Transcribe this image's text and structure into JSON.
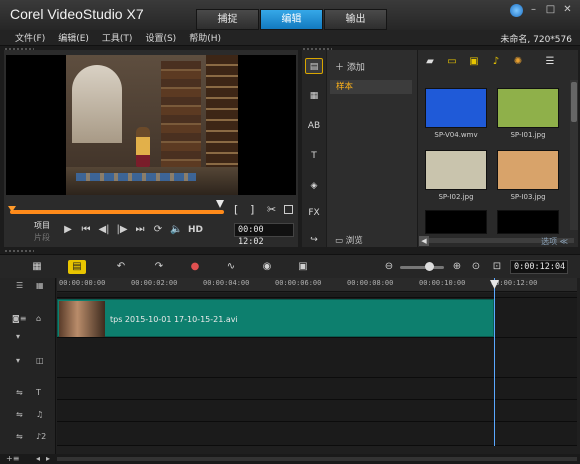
{
  "app": {
    "title": "Corel  VideoStudio X7",
    "tabs": [
      "捕捉",
      "编辑",
      "输出"
    ],
    "active_tab": "编辑",
    "project_info": "未命名, 720*576"
  },
  "menu": [
    "文件(F)",
    "编辑(E)",
    "工具(T)",
    "设置(S)",
    "帮助(H)"
  ],
  "preview": {
    "mode_project": "项目",
    "mode_clip": "片段",
    "hd_label": "HD",
    "timecode": "00:00 12:02"
  },
  "library": {
    "add_label": "添加",
    "folder": "样本",
    "browse_label": "浏览",
    "options_label": "选项",
    "thumbs": [
      {
        "label": "SP-V04.wmv",
        "color": "#1f5ad8"
      },
      {
        "label": "SP-I01.jpg",
        "color": "#8fb04a"
      },
      {
        "label": "SP-I02.jpg",
        "color": "#c9c4ad"
      },
      {
        "label": "SP-I03.jpg",
        "color": "#d8a36a"
      }
    ]
  },
  "timeline": {
    "timecode": "0:00:12:04",
    "ruler": [
      "00:00:00:00",
      "00:00:02:00",
      "00:00:04:00",
      "00:00:06:00",
      "00:00:08:00",
      "00:00:10:00",
      "00:00:12:00"
    ],
    "clip_name": "tps 2015-10-01 17-10-15-21.avi"
  }
}
